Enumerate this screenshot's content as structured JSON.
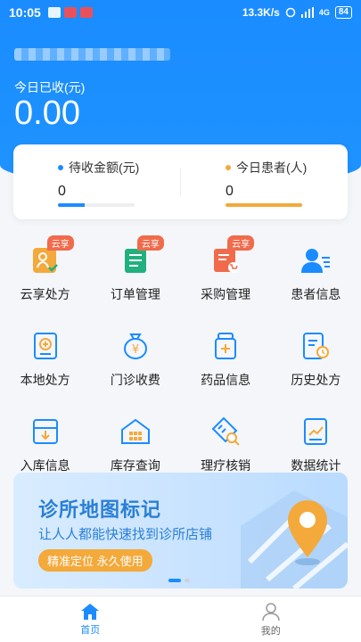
{
  "status_bar": {
    "time": "10:05",
    "net_speed": "13.3K/s",
    "network": "4G",
    "battery": "84"
  },
  "header": {
    "today_label": "今日已收(元)",
    "today_value": "0.00"
  },
  "stats": [
    {
      "label": "待收金额(元)",
      "value": "0",
      "color": "#1a8cff",
      "fill": 0.35
    },
    {
      "label": "今日患者(人)",
      "value": "0",
      "color": "#f4a93b",
      "fill": 1.0
    }
  ],
  "grid": [
    {
      "label": "云享处方",
      "icon": "cloud-prescription-icon",
      "badge": "云享"
    },
    {
      "label": "订单管理",
      "icon": "order-management-icon",
      "badge": "云享"
    },
    {
      "label": "采购管理",
      "icon": "purchase-management-icon",
      "badge": "云享"
    },
    {
      "label": "患者信息",
      "icon": "patient-info-icon",
      "badge": ""
    },
    {
      "label": "本地处方",
      "icon": "local-prescription-icon",
      "badge": ""
    },
    {
      "label": "门诊收费",
      "icon": "outpatient-fee-icon",
      "badge": ""
    },
    {
      "label": "药品信息",
      "icon": "medicine-info-icon",
      "badge": ""
    },
    {
      "label": "历史处方",
      "icon": "history-prescription-icon",
      "badge": ""
    },
    {
      "label": "入库信息",
      "icon": "stock-in-icon",
      "badge": ""
    },
    {
      "label": "库存查询",
      "icon": "inventory-query-icon",
      "badge": ""
    },
    {
      "label": "理疗核销",
      "icon": "therapy-writeoff-icon",
      "badge": ""
    },
    {
      "label": "数据统计",
      "icon": "statistics-icon",
      "badge": ""
    }
  ],
  "banner": {
    "title": "诊所地图标记",
    "subtitle": "让人人都能快速找到诊所店铺",
    "pill": "精准定位 永久使用"
  },
  "tabs": [
    {
      "label": "首页",
      "icon": "home-icon",
      "active": true
    },
    {
      "label": "我的",
      "icon": "profile-icon",
      "active": false
    }
  ],
  "colors": {
    "primary": "#1a8cff",
    "accent_orange": "#f4a93b",
    "badge_red": "#f06b4c",
    "green": "#22b07d"
  }
}
